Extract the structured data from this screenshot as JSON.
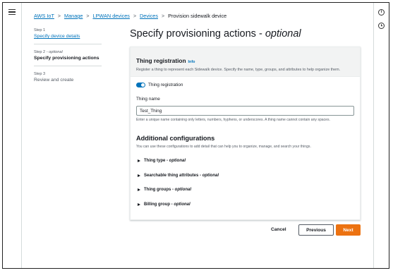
{
  "breadcrumb": {
    "items": [
      "AWS IoT",
      "Manage",
      "LPWAN devices",
      "Devices"
    ],
    "current": "Provision sidewalk device",
    "separator": ">"
  },
  "steps": [
    {
      "number": "Step 1",
      "title": "Specify device details"
    },
    {
      "number": "Step 2",
      "number_suffix": "- optional",
      "title": "Specify provisioning actions"
    },
    {
      "number": "Step 3",
      "title": "Review and create"
    }
  ],
  "page_title": {
    "main": "Specify provisioning actions - ",
    "optional": "optional"
  },
  "card": {
    "title": "Thing registration",
    "info": "Info",
    "description": "Register a thing to represent each Sidewalk device. Specify the name, type, groups, and attributes to help organize them.",
    "toggle": {
      "label": "Thing registration",
      "state": "on"
    },
    "field": {
      "label": "Thing name",
      "value": "Test_Thing",
      "hint": "Enter a unique name containing only letters, numbers, hyphens, or underscores. A thing name cannot contain any spaces."
    },
    "additional": {
      "title": "Additional configurations",
      "description": "You can use these configurations to add detail that can help you to organize, manage, and search your things.",
      "expanders": [
        {
          "label": "Thing type - ",
          "optional": "optional"
        },
        {
          "label": "Searchable thing attributes - ",
          "optional": "optional"
        },
        {
          "label": "Thing groups - ",
          "optional": "optional"
        },
        {
          "label": "Billing group - ",
          "optional": "optional"
        }
      ]
    }
  },
  "actions": {
    "cancel": "Cancel",
    "previous": "Previous",
    "next": "Next"
  },
  "rail_icons": {
    "info": "i",
    "clock": "clock-icon"
  },
  "colors": {
    "link": "#0073bb",
    "primary": "#ec7211",
    "toggle": "#0073bb"
  }
}
